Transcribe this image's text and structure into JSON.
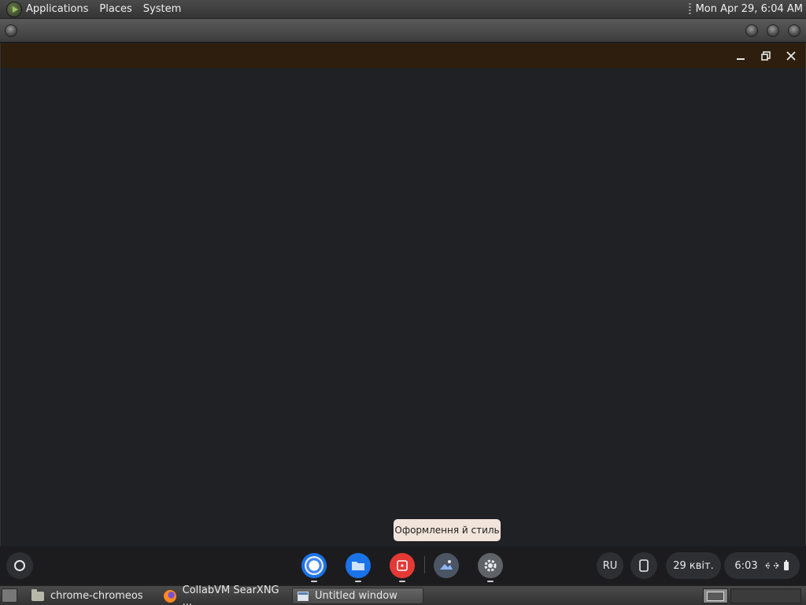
{
  "top_panel": {
    "menus": [
      "Applications",
      "Places",
      "System"
    ],
    "clock": "Mon Apr 29,  6:04 AM"
  },
  "tooltip": "Оформлення й стиль",
  "shelf": {
    "apps": [
      {
        "name": "chrome-icon",
        "color": "#4285f4"
      },
      {
        "name": "files-icon",
        "color": "#1a73e8"
      },
      {
        "name": "app-red-icon",
        "color": "#e53935"
      },
      {
        "name": "wallpaper-style-icon",
        "color": "#5f6b7a"
      },
      {
        "name": "settings-icon",
        "color": "#5f6368"
      }
    ],
    "ime": "RU",
    "date": "29 квіт.",
    "time": "6:03"
  },
  "taskbar": {
    "tasks": [
      "chrome-chromeos",
      "CollabVM SearXNG ...",
      "Untitled window"
    ]
  },
  "colors": {
    "app_titlebar": "#2d1e0e",
    "app_background": "#202124",
    "tooltip_bg": "#f1e4da"
  }
}
